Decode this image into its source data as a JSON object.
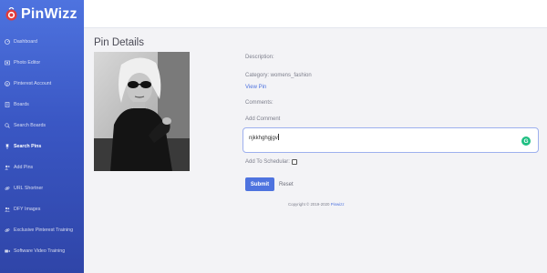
{
  "app": {
    "logo_text": "PinWizz",
    "brand_color": "#4e73df"
  },
  "sidebar": {
    "items": [
      {
        "label": "Dashboard",
        "icon": "dashboard-icon",
        "active": false
      },
      {
        "label": "Photo Editor",
        "icon": "photo-editor-icon",
        "active": false
      },
      {
        "label": "Pinterest Account",
        "icon": "pinterest-icon",
        "active": false
      },
      {
        "label": "Boards",
        "icon": "boards-icon",
        "active": false
      },
      {
        "label": "Search Boards",
        "icon": "search-icon",
        "active": false
      },
      {
        "label": "Search Pins",
        "icon": "pin-icon",
        "active": true
      },
      {
        "label": "Add Pins",
        "icon": "add-user-icon",
        "active": false
      },
      {
        "label": "URL Shortner",
        "icon": "link-icon",
        "active": false
      },
      {
        "label": "DFY Images",
        "icon": "users-icon",
        "active": false
      },
      {
        "label": "Exclusive Pinterest Training",
        "icon": "link-icon",
        "active": false
      },
      {
        "label": "Software Video Training",
        "icon": "video-icon",
        "active": false
      }
    ]
  },
  "main": {
    "title": "Pin Details",
    "description_label": "Description:",
    "category_label": "Category: womens_fashion",
    "view_pin_label": "View Pin",
    "comments_label": "Comments:",
    "add_comment_label": "Add Comment",
    "comment_value": "njkkhghgjgv",
    "grammarly_icon": "grammarly-icon",
    "add_to_scheduler_label": "Add To Schedular:",
    "submit_label": "Submit",
    "reset_label": "Reset"
  },
  "footer": {
    "copyright": "Copyright © 2019-2020 ",
    "brand": "Pinwizz"
  }
}
